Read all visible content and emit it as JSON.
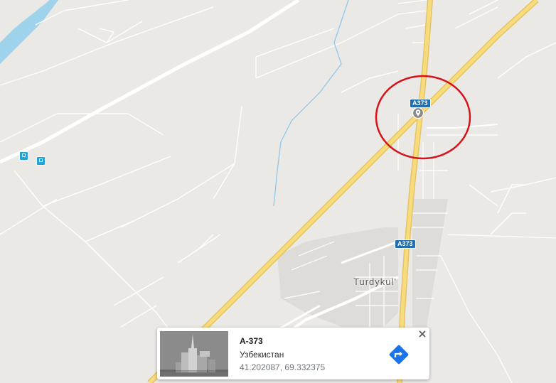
{
  "map": {
    "road_shield_a": "A373",
    "road_shield_b": "A373",
    "place_label": "Turdykul'",
    "marker_icon": "map-pin-icon",
    "highlight_color": "#d7121a"
  },
  "info_card": {
    "title": "A-373",
    "country": "Узбекистан",
    "coordinates": "41.202087, 69.332375",
    "directions_icon": "directions-icon",
    "close_icon": "close-icon",
    "accent_color": "#1a73e8"
  }
}
